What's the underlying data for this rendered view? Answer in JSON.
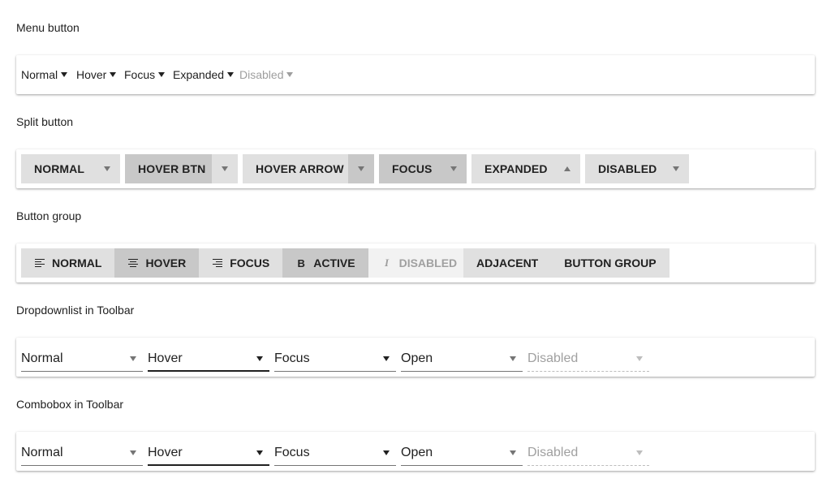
{
  "sections": {
    "menu_button": "Menu button",
    "split_button": "Split button",
    "button_group": "Button group",
    "dropdownlist": "Dropdownlist in Toolbar",
    "combobox": "Combobox in Toolbar"
  },
  "menu_buttons": [
    "Normal",
    "Hover",
    "Focus",
    "Expanded",
    "Disabled"
  ],
  "split_buttons": [
    "NORMAL",
    "HOVER BTN",
    "HOVER ARROW",
    "FOCUS",
    "EXPANDED",
    "DISABLED"
  ],
  "button_group": {
    "buttons": [
      "NORMAL",
      "HOVER",
      "FOCUS",
      "ACTIVE",
      "DISABLED"
    ],
    "adjacent": [
      "ADJACENT",
      "BUTTON GROUP"
    ],
    "icons": [
      "align-left-icon",
      "align-center-icon",
      "align-right-icon",
      "bold-icon",
      "italic-icon"
    ]
  },
  "dropdownlist": [
    "Normal",
    "Hover",
    "Focus",
    "Open",
    "Disabled"
  ],
  "combobox": [
    "Normal",
    "Hover",
    "Focus",
    "Open",
    "Disabled"
  ],
  "colors": {
    "button_bg": "#e0e0e0",
    "button_hover_bg": "#c8c8c8",
    "disabled_text": "#9e9e9e"
  }
}
